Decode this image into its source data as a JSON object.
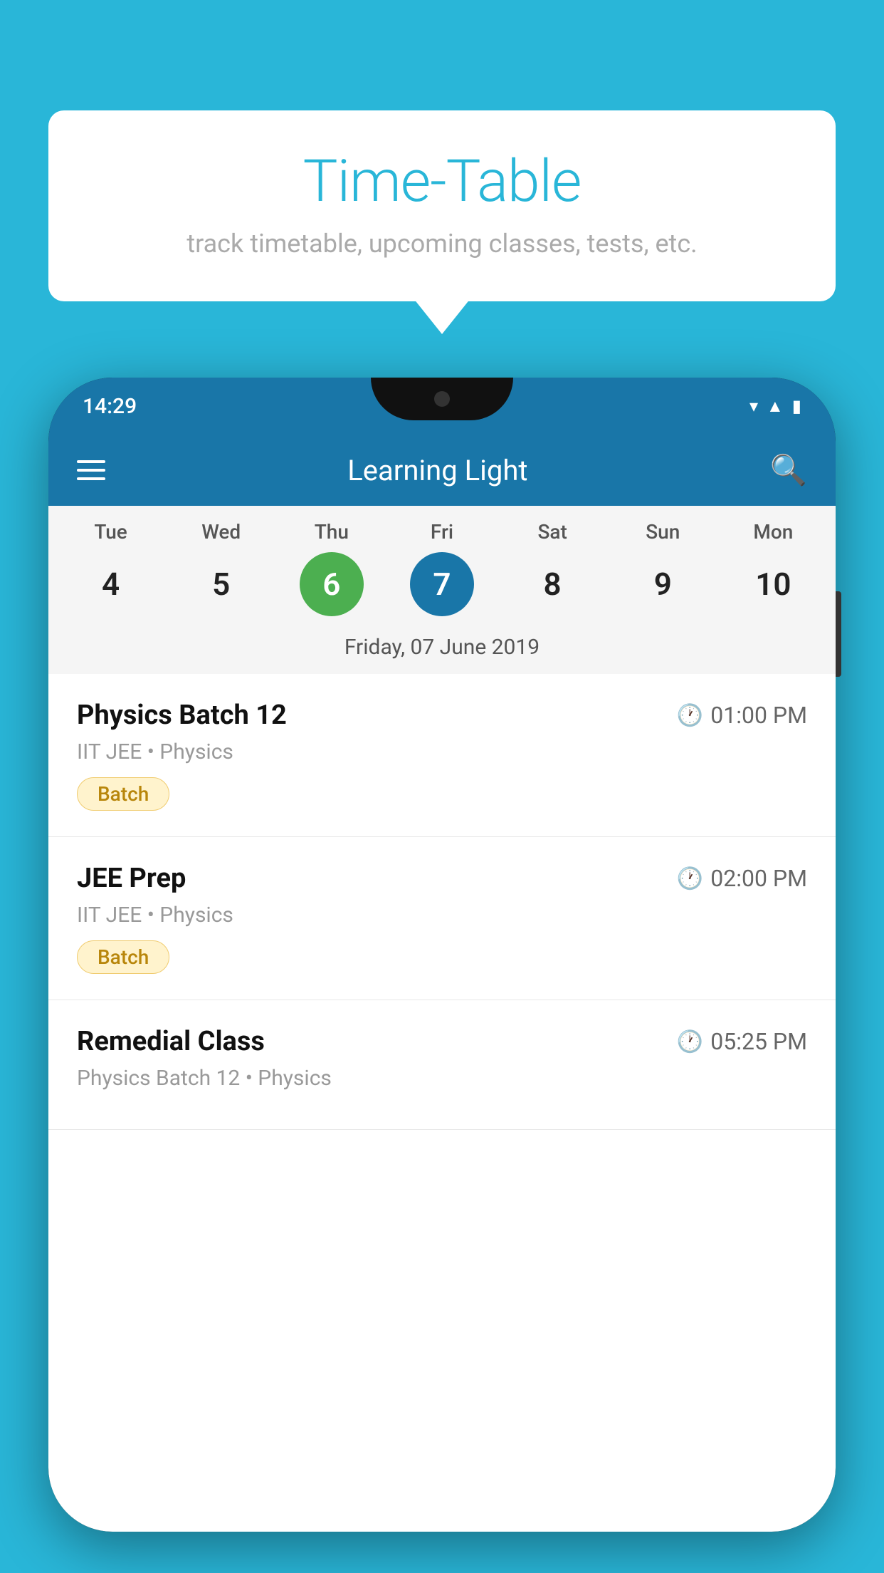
{
  "background_color": "#29B6D8",
  "tooltip": {
    "title": "Time-Table",
    "subtitle": "track timetable, upcoming classes, tests, etc."
  },
  "phone": {
    "status_bar": {
      "time": "14:29",
      "icons": [
        "wifi",
        "signal",
        "battery"
      ]
    },
    "toolbar": {
      "title": "Learning Light",
      "menu_label": "menu",
      "search_label": "search"
    },
    "calendar": {
      "weekdays": [
        {
          "label": "Tue",
          "number": "4"
        },
        {
          "label": "Wed",
          "number": "5"
        },
        {
          "label": "Thu",
          "number": "6",
          "state": "today"
        },
        {
          "label": "Fri",
          "number": "7",
          "state": "selected"
        },
        {
          "label": "Sat",
          "number": "8"
        },
        {
          "label": "Sun",
          "number": "9"
        },
        {
          "label": "Mon",
          "number": "10"
        }
      ],
      "selected_date_label": "Friday, 07 June 2019"
    },
    "schedule": [
      {
        "title": "Physics Batch 12",
        "time": "01:00 PM",
        "subtitle": "IIT JEE • Physics",
        "badge": "Batch"
      },
      {
        "title": "JEE Prep",
        "time": "02:00 PM",
        "subtitle": "IIT JEE • Physics",
        "badge": "Batch"
      },
      {
        "title": "Remedial Class",
        "time": "05:25 PM",
        "subtitle": "Physics Batch 12 • Physics",
        "badge": null
      }
    ]
  }
}
